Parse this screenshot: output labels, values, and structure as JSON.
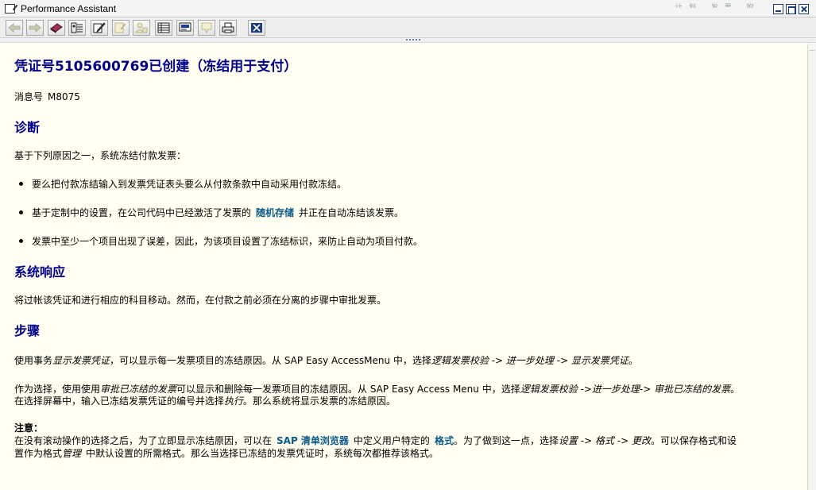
{
  "window": {
    "title": "Performance Assistant",
    "behind_text": "…  计划    发票    附件   "
  },
  "colors": {
    "heading": "#00008b",
    "link": "#0a5a8a",
    "background": "#fffef0"
  },
  "toolbar": {
    "buttons": [
      {
        "name": "back-button",
        "icon": "arrow-left-icon",
        "enabled": false
      },
      {
        "name": "forward-button",
        "icon": "arrow-right-icon",
        "enabled": false
      },
      {
        "name": "book-button",
        "icon": "book-icon",
        "enabled": true
      },
      {
        "name": "technical-info-button",
        "icon": "technical-info-icon",
        "enabled": true
      },
      {
        "name": "edit-button",
        "icon": "pencil-icon",
        "enabled": true
      },
      {
        "name": "annotation-button",
        "icon": "annotation-icon",
        "enabled": false
      },
      {
        "name": "assign-button",
        "icon": "people-icon",
        "enabled": false
      },
      {
        "name": "table-button",
        "icon": "table-icon",
        "enabled": true
      },
      {
        "name": "layout-button",
        "icon": "layout-icon",
        "enabled": true
      },
      {
        "name": "tip-button",
        "icon": "tip-icon",
        "enabled": false
      },
      {
        "name": "print-button",
        "icon": "printer-icon",
        "enabled": true
      },
      {
        "name": "exit-button",
        "icon": "close-box-icon",
        "enabled": true
      }
    ]
  },
  "doc": {
    "title": "凭证号5105600769已创建（冻结用于支付）",
    "message_label": "消息号",
    "message_number": "M8075",
    "diagnosis": {
      "heading": "诊断",
      "intro": "基于下列原因之一，系统冻结付款发票：",
      "b1": "要么把付款冻结输入到发票凭证表头要么从付款条款中自动采用付款冻结。",
      "b2_pre": "基于定制中的设置，在公司代码中已经激活了发票的",
      "b2_link": "随机存储",
      "b2_post": "并正在自动冻结该发票。",
      "b3": "发票中至少一个项目出现了误差，因此，为该项目设置了冻结标识，来防止自动为项目付款。"
    },
    "response": {
      "heading": "系统响应",
      "text": "将过帐该凭证和进行相应的科目移动。然而，在付款之前必须在分离的步骤中审批发票。"
    },
    "steps": {
      "heading": "步骤",
      "p1_a": "使用事务",
      "p1_b": "显示发票凭证",
      "p1_c": "，可以显示每一发票项目的冻结原因。从  SAP Easy AccessMenu 中，选择",
      "p1_d": "逻辑发票校验  -> 进一步处理  -> 显示发票凭证",
      "p1_e": "。",
      "p2_a": "作为选择，使用使用",
      "p2_b": "审批已冻结的发票",
      "p2_c": "可以显示和删除每一发票项目的冻结原因。从  SAP Easy Access Menu 中，选择",
      "p2_d": "逻辑发票校验 ->进一步处理-> 审批已冻结的发票",
      "p2_e": "。",
      "p2_line2_a": "在选择屏幕中，输入已冻结发票凭证的编号并选择",
      "p2_line2_b": "执行",
      "p2_line2_c": "。那么系统将显示发票的冻结原因。",
      "note_label": "注意：",
      "n1_a": "在没有滚动操作的选择之后，为了立即显示冻结原因，可以在",
      "n1_link1": "SAP 清单浏览器",
      "n1_b": "中定义用户特定的",
      "n1_link2": "格式",
      "n1_c": "。为了做到这一点，选择",
      "n1_d": "设置  -> 格式  -> 更改",
      "n1_e": "。可以保存格式和设",
      "n2_a": "置作为格式",
      "n2_b": "管理",
      "n2_c": "中默认设置的所需格式。那么当选择已冻结的发票凭证时，系统每次都推荐该格式。"
    }
  }
}
